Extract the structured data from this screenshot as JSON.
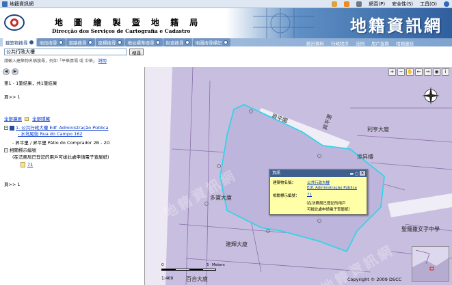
{
  "browser": {
    "tab_title": "地籍資訊網",
    "menu": [
      "網頁(P)",
      "安全性(S)",
      "工具(O)"
    ]
  },
  "header": {
    "dept_cn": "地 圖 繪 製 暨 地 籍 局",
    "dept_pt": "Direcção dos Serviços de Cartografia e Cadastro",
    "site_title": "地籍資訊網"
  },
  "nav": {
    "items": [
      "建築物搜尋",
      "地段搜尋",
      "道路搜尋",
      "座標搜尋",
      "地址標準搜尋",
      "街道搜尋",
      "地圖搜尋標記"
    ],
    "sublinks": [
      "統計資料",
      "行政程序",
      "法例",
      "用戶指南",
      "相關連結"
    ]
  },
  "search": {
    "value": "公共行政大樓",
    "button": "搜尋",
    "hint": "請輸入建築物名稱搜尋，例如「平華廣場 或 中華」",
    "hint_link": "說明"
  },
  "results": {
    "summary": "第1 - 1筆結果，共1筆結果",
    "page1": "頁>> 1",
    "expand_all": "全部擴展",
    "collapse_all": "全部隱藏",
    "item_title": "1. 公共行政大樓 Edf. Administração Pública",
    "item_addr": "- 水坑尾街 Rua do Campo 162",
    "item_sub": "- 昇平里 / 昇平里 Pátio do Comprador 2B - 2D",
    "related": "相關標示編號",
    "note": "(在法務局已登記的用戶可拔此處申請電子查屋紙)",
    "ref_link": "71",
    "page2": "頁>> 1"
  },
  "map": {
    "labels": [
      "昇平圍",
      "昇平里",
      "利亨大廈",
      "添昇樓",
      "多寶大廈",
      "建輝大廈",
      "百合大廈",
      "聖羅撒女子中學"
    ],
    "watermark": "地籍資訊網",
    "scale_zero": "0",
    "scale_five": "5",
    "scale_unit": "Meters",
    "ratio": "1:400",
    "copyright": "Copyright © 2009 DSCC"
  },
  "popup": {
    "title": "資訊",
    "name_label": "建築物名稱：",
    "name_value": "公共行政大樓",
    "name_value_pt": "Edf. Administração Pública",
    "ref_label": "相關標示編號：",
    "ref_value": "71",
    "note1": "（在法務局已登記的用戶",
    "note2": "可拔此處申請電子查屋紙）"
  },
  "colors": {
    "map_bg": "#c8bfe0",
    "highlight": "#35d3e8",
    "popup_bg": "#ffffa8"
  }
}
